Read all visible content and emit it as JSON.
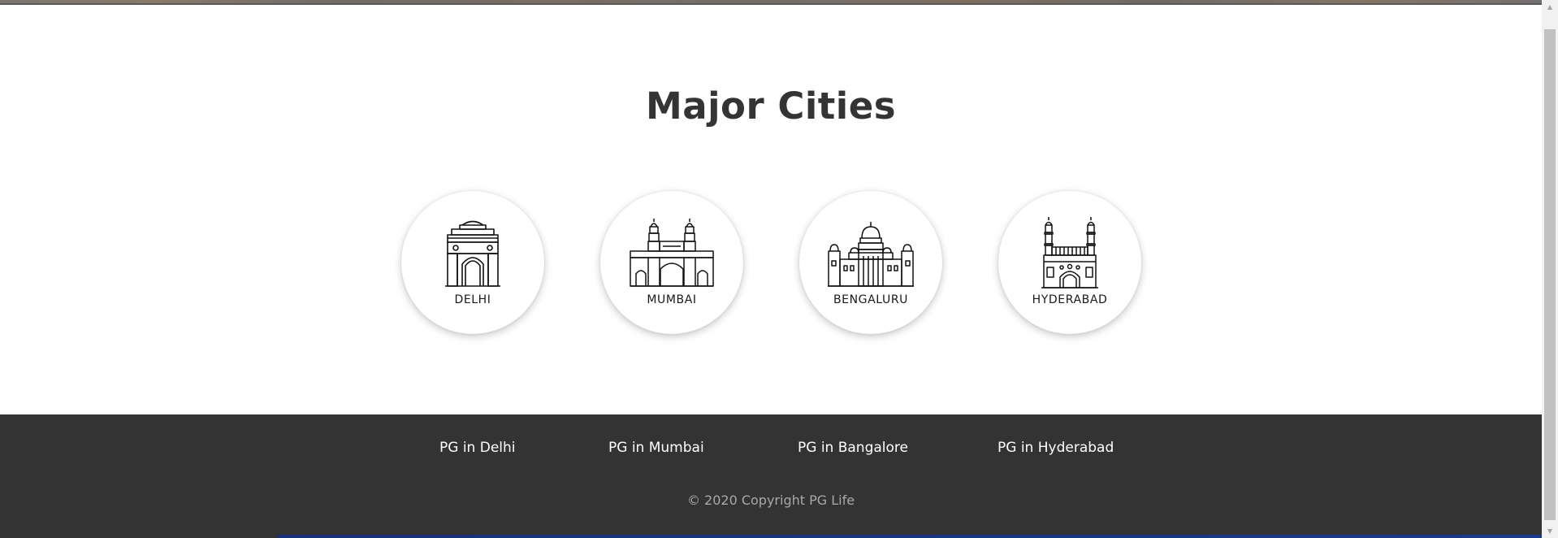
{
  "cities_section": {
    "title": "Major Cities",
    "cities": [
      {
        "name": "DELHI",
        "icon": "india-gate-icon"
      },
      {
        "name": "MUMBAI",
        "icon": "gateway-of-india-icon"
      },
      {
        "name": "BENGALURU",
        "icon": "vidhana-soudha-icon"
      },
      {
        "name": "HYDERABAD",
        "icon": "charminar-icon"
      }
    ]
  },
  "footer": {
    "links": [
      "PG in Delhi",
      "PG in Mumbai",
      "PG in Bangalore",
      "PG in Hyderabad"
    ],
    "copyright": "© 2020 Copyright PG Life"
  },
  "colors": {
    "footer_bg": "#333333",
    "title": "#343434",
    "copyright": "#a9a9a9"
  }
}
